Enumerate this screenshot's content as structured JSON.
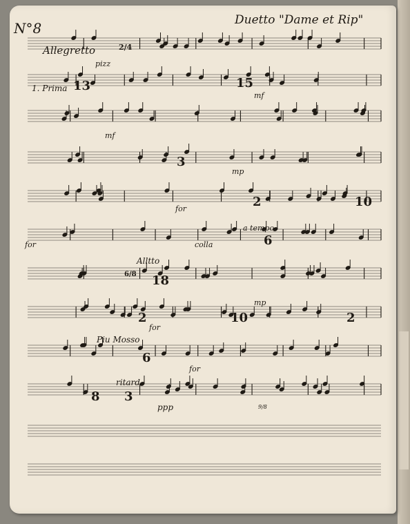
{
  "header": {
    "number": "N°8",
    "title": "Duetto \"Dame et Rip\""
  },
  "markings": {
    "tempo_start": "Allegretto",
    "meter_start": "2/4",
    "prima": "1. Prima",
    "pizz": "pizz",
    "mf": "mf",
    "mp": "mp",
    "for": "for",
    "colla": "colla",
    "a_tempo": "a tempo",
    "allegro": "Alltto",
    "meter_68": "6/8",
    "piu_mosso": "Piu Mosso",
    "ritard": "ritard",
    "ppp": "ppp",
    "mp2": "mp",
    "mf2": "mf",
    "for2": "for",
    "for3": "for",
    "corner_mark": "9/8"
  },
  "rests": {
    "r13": "13",
    "r15": "15",
    "r3_1": "3",
    "r2_1": "2",
    "r10_1": "10",
    "r6_1": "6",
    "r18": "18",
    "r2_2": "2",
    "r10_2": "10",
    "r2_3": "2",
    "r6_2": "6",
    "r8": "8",
    "r3_2": "3"
  }
}
